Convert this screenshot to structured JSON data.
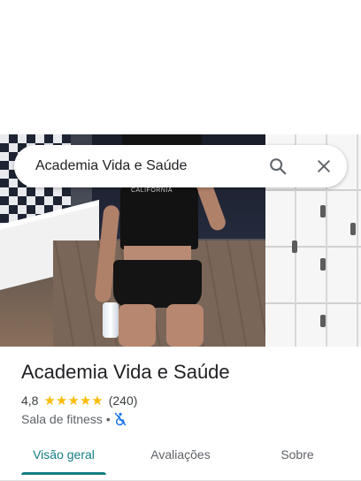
{
  "search": {
    "query": "Academia Vida e Saúde",
    "search_icon": "search-icon",
    "close_icon": "close-icon"
  },
  "place": {
    "name": "Academia Vida e Saúde",
    "rating": "4,8",
    "stars": 5,
    "review_count": "(240)",
    "category": "Sala de fitness",
    "separator": "•",
    "accessibility_icon": "wheelchair-crossed-icon"
  },
  "tabs": [
    {
      "label": "Visão geral",
      "active": true
    },
    {
      "label": "Avaliações",
      "active": false
    },
    {
      "label": "Sobre",
      "active": false
    }
  ],
  "colors": {
    "accent": "#137e84",
    "star": "#fbbc04",
    "accessibility_icon": "#1a73e8"
  }
}
